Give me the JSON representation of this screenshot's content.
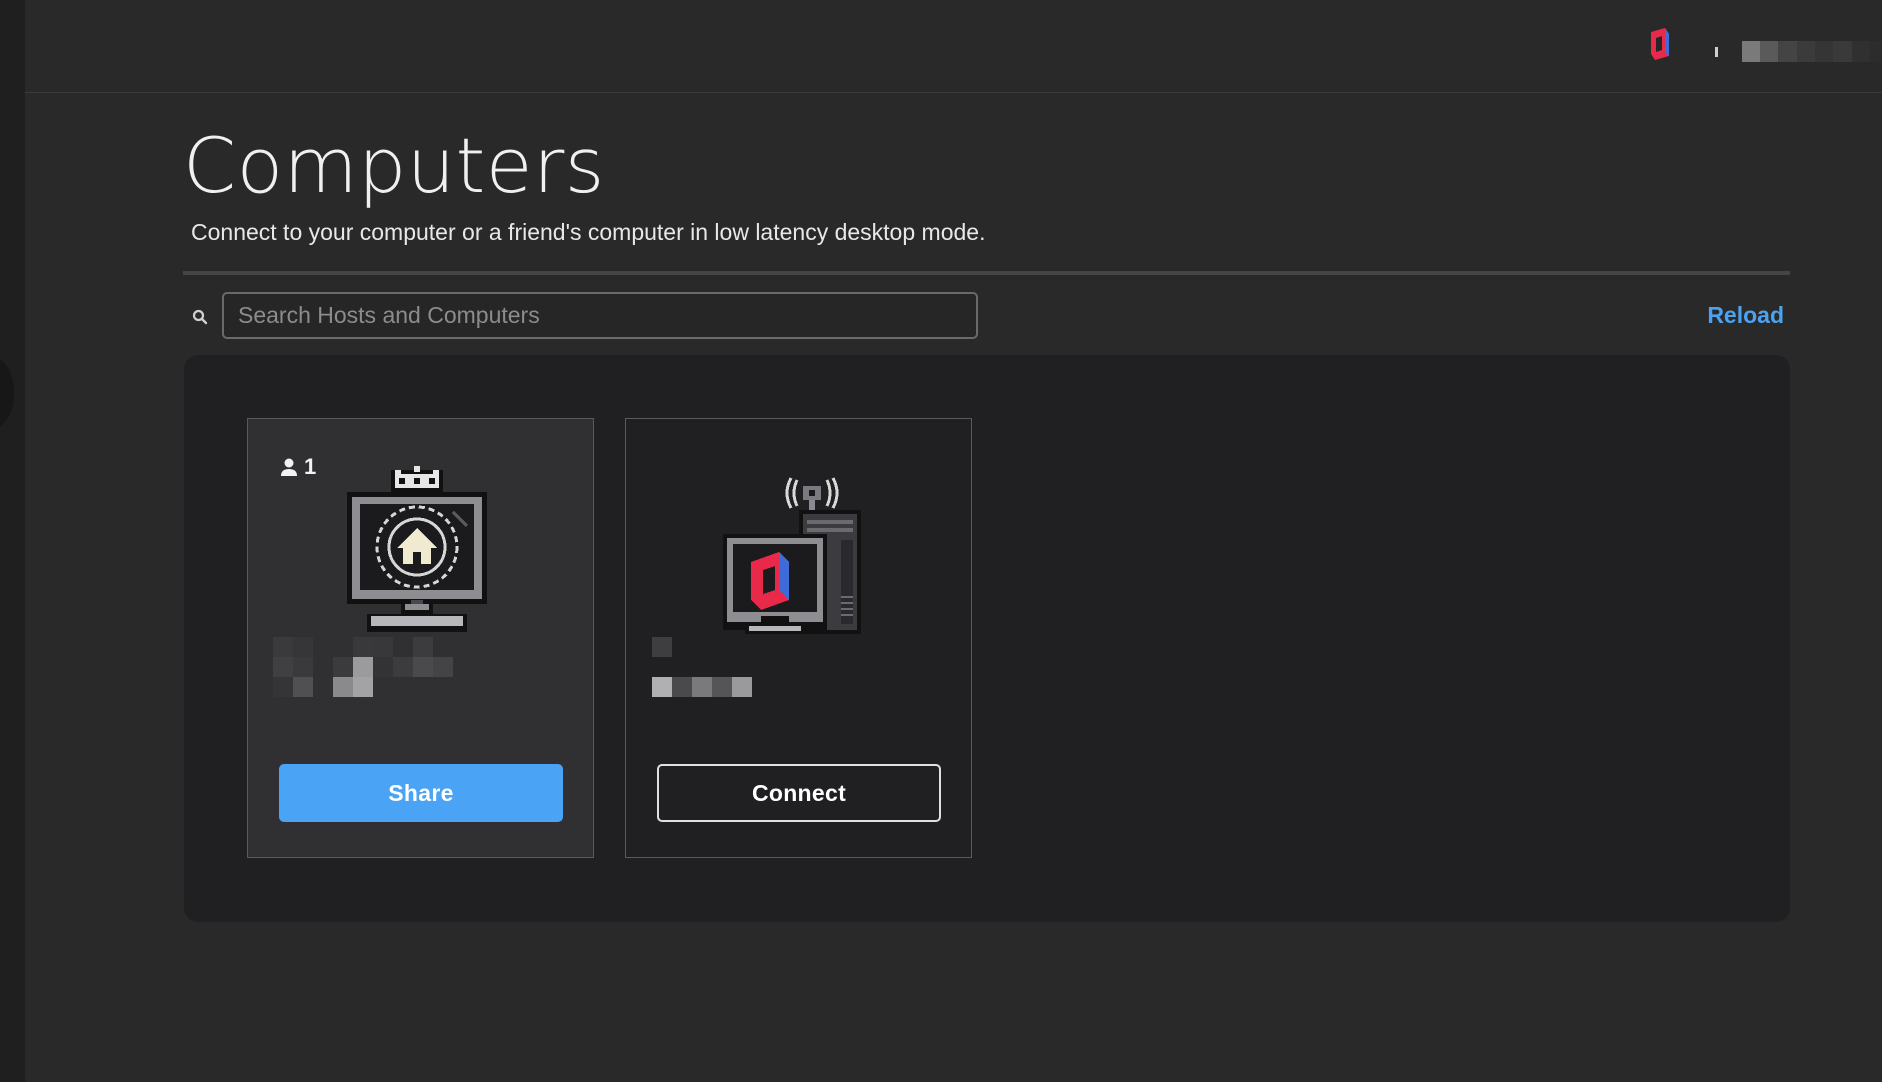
{
  "header": {
    "title": "Computers",
    "subtitle": "Connect to your computer or a friend's computer in low latency desktop mode."
  },
  "search": {
    "placeholder": "Search Hosts and Computers",
    "value": ""
  },
  "actions": {
    "reload_label": "Reload"
  },
  "colors": {
    "accent": "#4ba3f5",
    "background": "#292929",
    "panel": "#202022",
    "brand_red": "#e8294a",
    "brand_blue": "#3e6bd8"
  },
  "icons": {
    "search": "search-icon",
    "user": "user-icon",
    "brand": "parsec-logo-icon",
    "home_computer": "home-computer-icon",
    "connect_computer": "desktop-tower-icon"
  },
  "computers": [
    {
      "guest_count": "1",
      "button_label": "Share",
      "name_redacted": true
    },
    {
      "button_label": "Connect",
      "name_redacted": true
    }
  ]
}
